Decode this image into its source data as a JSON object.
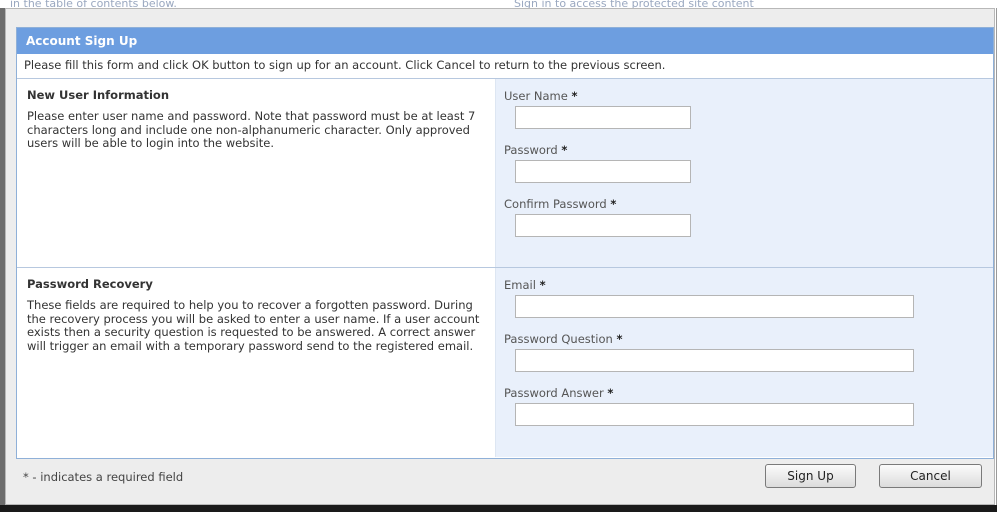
{
  "background": {
    "left_text": "in the table of contents below.",
    "right_text": "Sign in to access the protected site content"
  },
  "dialog": {
    "title": "Account Sign Up",
    "intro": "Please fill this form and click OK button to sign up for an account. Click Cancel to return to the previous screen.",
    "required_marker": "*"
  },
  "new_user": {
    "title": "New User Information",
    "description": "Please enter user name and password. Note that password must be at least 7 characters long and include one non-alphanumeric character. Only approved users will be able to login into the website.",
    "fields": [
      {
        "label": "User Name",
        "value": ""
      },
      {
        "label": "Password",
        "value": ""
      },
      {
        "label": "Confirm Password",
        "value": ""
      }
    ]
  },
  "recovery": {
    "title": "Password Recovery",
    "description": "These fields are required to help you to recover a forgotten password. During the recovery process you will be asked to enter a user name. If a user account exists then a security question is requested to be answered. A correct answer will trigger an email with a temporary password send to the registered email.",
    "fields": [
      {
        "label": "Email",
        "value": ""
      },
      {
        "label": "Password Question",
        "value": ""
      },
      {
        "label": "Password Answer",
        "value": ""
      }
    ]
  },
  "footer": {
    "note": "* - indicates a required field",
    "signup_label": "Sign Up",
    "cancel_label": "Cancel"
  },
  "colors": {
    "title_bar": "#6d9ee0",
    "field_panel": "#e9f0fb",
    "border": "#8fb0d8"
  }
}
